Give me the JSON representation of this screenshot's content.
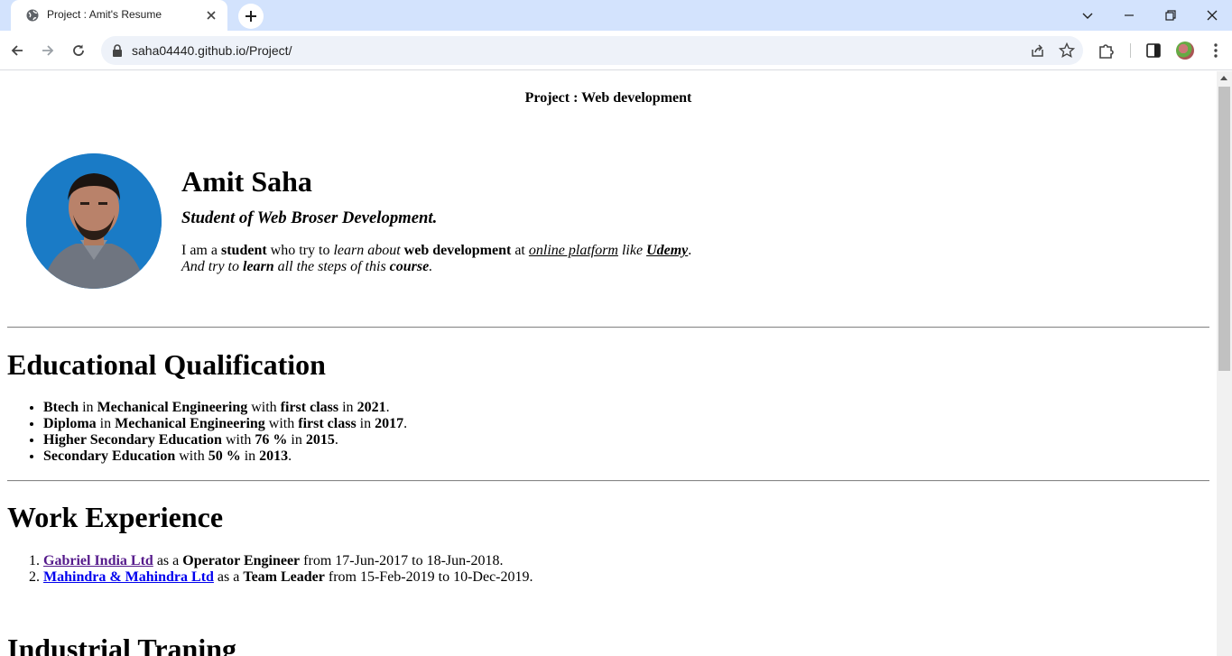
{
  "browser": {
    "tab_title": "Project : Amit's Resume",
    "url": "saha04440.github.io/Project/"
  },
  "page": {
    "title": "Project : Web development",
    "name": "Amit Saha",
    "tagline": "Student of Web Broser Development.",
    "intro": {
      "p1": "I am a ",
      "b1": "student",
      "p2": " who try to ",
      "i1": "learn about",
      "p3": " ",
      "b2": "web development",
      "p4": " at ",
      "u1": "online platform",
      "p5": " ",
      "i2": "like",
      "p6": " ",
      "u2": "Udemy",
      "p7": ".",
      "l2_i1": "And try to ",
      "l2_b1": "learn",
      "l2_i2": " all the steps of this ",
      "l2_b2": "course",
      "l2_i3": "."
    },
    "education": {
      "heading": "Educational Qualification",
      "items": [
        {
          "degree": "Btech",
          "t1": " in ",
          "field": "Mechanical Engineering",
          "t2": " with ",
          "grade": "first class",
          "t3": " in ",
          "year": "2021",
          "t4": "."
        },
        {
          "degree": "Diploma",
          "t1": " in ",
          "field": "Mechanical Engineering",
          "t2": " with ",
          "grade": "first class",
          "t3": " in ",
          "year": "2017",
          "t4": "."
        },
        {
          "degree": "Higher Secondary Education",
          "t1": "",
          "field": "",
          "t2": " with ",
          "grade": "76 %",
          "t3": " in ",
          "year": "2015",
          "t4": "."
        },
        {
          "degree": "Secondary Education",
          "t1": "",
          "field": "",
          "t2": " with ",
          "grade": "50 %",
          "t3": " in ",
          "year": "2013",
          "t4": "."
        }
      ]
    },
    "work": {
      "heading": "Work Experience",
      "items": [
        {
          "company": "Gabriel India Ltd",
          "t1": " as a ",
          "role": "Operator Engineer",
          "t2": " from 17-Jun-2017 to 18-Jun-2018."
        },
        {
          "company": "Mahindra & Mahindra Ltd",
          "t1": " as a ",
          "role": "Team Leader",
          "t2": " from 15-Feb-2019 to 10-Dec-2019."
        }
      ]
    },
    "training": {
      "heading": "Industrial Traning"
    }
  }
}
